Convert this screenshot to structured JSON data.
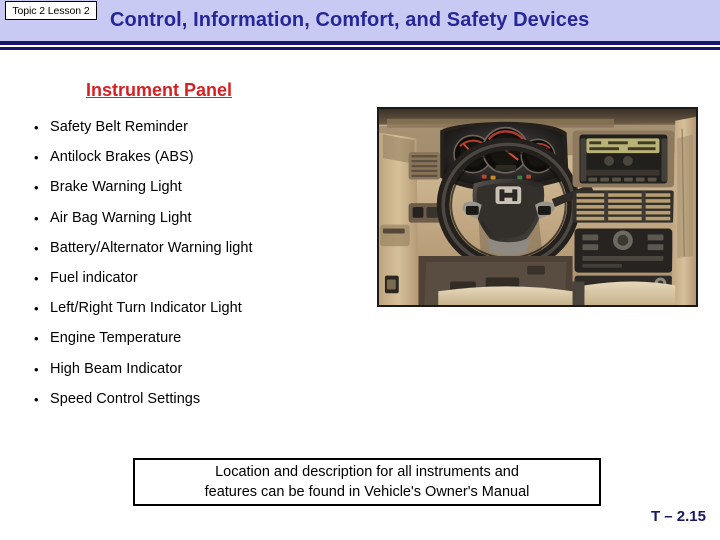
{
  "header": {
    "topic_tab": "Topic 2 Lesson 2",
    "title": "Control, Information, Comfort, and Safety Devices",
    "band_color": "#c9caf4",
    "title_color": "#262698",
    "rule_color": "#17176b"
  },
  "main": {
    "subtitle": "Instrument Panel",
    "subtitle_color": "#d81f21",
    "bullet_glyph": "•",
    "bullets": [
      {
        "label": "Safety Belt Reminder"
      },
      {
        "label": "Antilock Brakes (ABS)"
      },
      {
        "label": "Brake Warning Light"
      },
      {
        "label": "Air Bag Warning Light"
      },
      {
        "label": "Battery/Alternator Warning light"
      },
      {
        "label": "Fuel indicator"
      },
      {
        "label": "Left/Right Turn Indicator Light"
      },
      {
        "label": "Engine Temperature"
      },
      {
        "label": "High Beam Indicator"
      },
      {
        "label": "Speed Control Settings"
      }
    ],
    "photo": {
      "name": "vehicle-instrument-panel-photo",
      "description": "Car interior dashboard with steering wheel, instrument cluster, audio head unit and center console"
    }
  },
  "callout": {
    "line1": "Location and description for all instruments and",
    "line2": "features can be found in Vehicle's Owner's Manual"
  },
  "footer": {
    "slide_code": "T – 2.15",
    "code_color": "#17176b"
  }
}
